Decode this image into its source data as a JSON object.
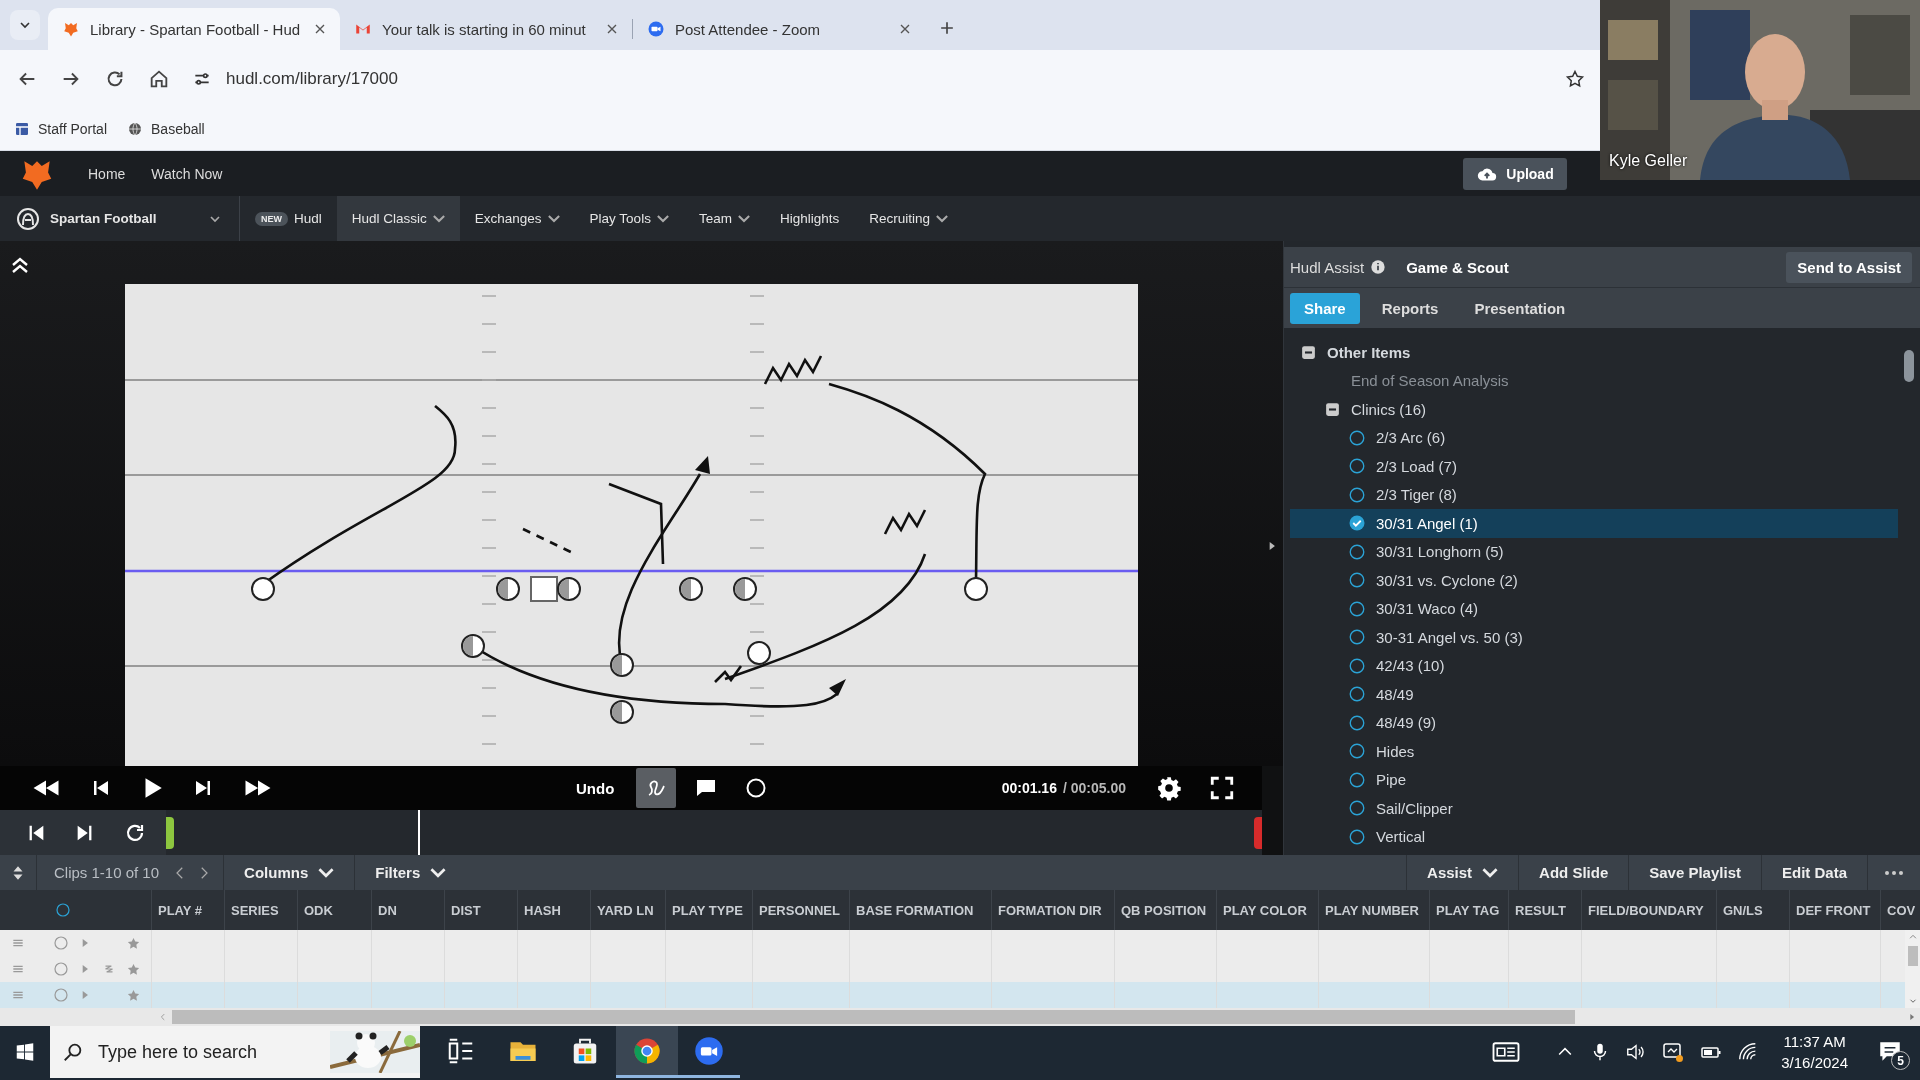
{
  "browser": {
    "tabs": [
      {
        "title": "Library - Spartan Football - Hud",
        "kind": "hudl",
        "selected": true
      },
      {
        "title": "Your talk is starting in 60 minut",
        "kind": "mail",
        "selected": false
      },
      {
        "title": "Post Attendee - Zoom",
        "kind": "zoom",
        "selected": false
      }
    ],
    "address": "hudl.com/library/17000",
    "bookmarks": [
      {
        "label": "Staff Portal",
        "kind": "portal"
      },
      {
        "label": "Baseball",
        "kind": "globe"
      }
    ]
  },
  "hudl_nav": {
    "links": [
      "Home",
      "Watch Now"
    ],
    "upload": "Upload",
    "team": "Spartan Football",
    "menu": [
      {
        "label": "Hudl",
        "badge": "NEW",
        "dropdown": false,
        "selected": false
      },
      {
        "label": "Hudl Classic",
        "dropdown": true,
        "selected": true
      },
      {
        "label": "Exchanges",
        "dropdown": true,
        "selected": false
      },
      {
        "label": "Play Tools",
        "dropdown": true,
        "selected": false
      },
      {
        "label": "Team",
        "dropdown": true,
        "selected": false
      },
      {
        "label": "Highlights",
        "dropdown": false,
        "selected": false
      },
      {
        "label": "Recruiting",
        "dropdown": true,
        "selected": false
      }
    ]
  },
  "video": {
    "undo": "Undo",
    "tools": [
      {
        "kind": "draw",
        "selected": true
      },
      {
        "kind": "comment",
        "selected": false
      },
      {
        "kind": "circle",
        "selected": false
      }
    ],
    "current_time": "00:01.16",
    "duration": "/ 00:05.00",
    "timeline": {
      "level": 0.231
    }
  },
  "assist": {
    "label": "Hudl Assist",
    "title": "Game & Scout",
    "send": "Send to Assist",
    "tabs": [
      {
        "label": "Share",
        "selected": true
      },
      {
        "label": "Reports",
        "selected": false
      },
      {
        "label": "Presentation",
        "selected": false
      }
    ],
    "tree": [
      {
        "label": "Other Items",
        "expanded": true,
        "children": [
          {
            "label": "End of Season Analysis",
            "disabled": true
          },
          {
            "label": "Clinics (16)",
            "disabled": false,
            "expanded": true,
            "children": [
              {
                "label": "2/3 Arc (6)",
                "selected": false
              },
              {
                "label": "2/3 Load (7)",
                "selected": false
              },
              {
                "label": "2/3 Tiger (8)",
                "selected": false
              },
              {
                "label": "30/31 Angel (1)",
                "selected": true
              },
              {
                "label": "30/31 Longhorn (5)",
                "selected": false
              },
              {
                "label": "30/31 vs. Cyclone (2)",
                "selected": false
              },
              {
                "label": "30/31 Waco (4)",
                "selected": false
              },
              {
                "label": "30-31 Angel vs. 50 (3)",
                "selected": false
              },
              {
                "label": "42/43 (10)",
                "selected": false
              },
              {
                "label": "48/49",
                "selected": false
              },
              {
                "label": "48/49 (9)",
                "selected": false
              },
              {
                "label": "Hides",
                "selected": false
              },
              {
                "label": "Pipe",
                "selected": false
              },
              {
                "label": "Sail/Clipper",
                "selected": false
              },
              {
                "label": "Vertical",
                "selected": false
              }
            ]
          }
        ]
      }
    ]
  },
  "toolbar": {
    "clips": "Clips 1-10 of 10",
    "left": [
      {
        "label": "Columns",
        "dropdown": true
      },
      {
        "label": "Filters",
        "dropdown": true
      }
    ],
    "right": [
      {
        "label": "Assist",
        "dropdown": true
      },
      {
        "label": "Add Slide",
        "dropdown": false
      },
      {
        "label": "Save Playlist",
        "dropdown": false
      },
      {
        "label": "Edit Data",
        "dropdown": false
      }
    ]
  },
  "table": {
    "columns": [
      "PLAY #",
      "SERIES",
      "ODK",
      "DN",
      "DIST",
      "HASH",
      "YARD LN",
      "PLAY TYPE",
      "PERSONNEL",
      "BASE FORMATION",
      "FORMATION DIR",
      "QB POSITION",
      "PLAY COLOR",
      "PLAY NUMBER",
      "PLAY TAG",
      "RESULT",
      "FIELD/BOUNDARY",
      "GN/LS",
      "DEF FRONT",
      "COV"
    ],
    "rows": [
      {
        "selected": false,
        "drawing": false
      },
      {
        "selected": false,
        "drawing": true
      },
      {
        "selected": true,
        "drawing": false
      }
    ]
  },
  "taskbar": {
    "search_placeholder": "Type here to search",
    "apps": [
      {
        "kind": "taskview",
        "selected": false,
        "running": false
      },
      {
        "kind": "explorer",
        "selected": false,
        "running": false
      },
      {
        "kind": "store",
        "selected": false,
        "running": false
      },
      {
        "kind": "chrome",
        "selected": true,
        "running": true
      },
      {
        "kind": "zoom",
        "selected": false,
        "running": true
      }
    ],
    "time": "11:37 AM",
    "date": "3/16/2024",
    "notifications": "5"
  },
  "webcam": {
    "name": "Kyle Geller"
  }
}
